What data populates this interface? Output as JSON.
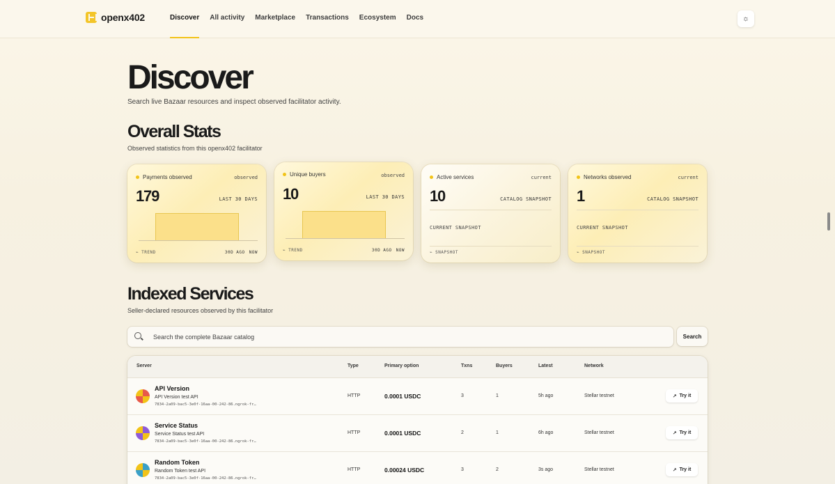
{
  "header": {
    "brand": "openx402",
    "nav": [
      "Discover",
      "All activity",
      "Marketplace",
      "Transactions",
      "Ecosystem",
      "Docs"
    ],
    "active_nav": "Discover",
    "theme_icon": "sun-icon"
  },
  "discover": {
    "title": "Discover",
    "subtitle": "Search live Bazaar resources and inspect observed facilitator activity."
  },
  "stats": {
    "title": "Overall Stats",
    "subtitle": "Observed statistics from this openx402 facilitator",
    "cards": [
      {
        "label": "Payments observed",
        "tag": "observed",
        "value": "179",
        "period": "LAST 30 DAYS",
        "foot_left": "TREND",
        "foot_from": "30D AGO",
        "foot_to": "NOW"
      },
      {
        "label": "Unique buyers",
        "tag": "observed",
        "value": "10",
        "period": "LAST 30 DAYS",
        "foot_left": "TREND",
        "foot_from": "30D AGO",
        "foot_to": "NOW"
      },
      {
        "label": "Active services",
        "tag": "current",
        "value": "10",
        "period": "CATALOG SNAPSHOT",
        "snapshot": "CURRENT SNAPSHOT",
        "foot_left": "SNAPSHOT"
      },
      {
        "label": "Networks observed",
        "tag": "current",
        "value": "1",
        "period": "CATALOG SNAPSHOT",
        "snapshot": "CURRENT SNAPSHOT",
        "foot_left": "SNAPSHOT"
      }
    ]
  },
  "services": {
    "title": "Indexed Services",
    "subtitle": "Seller-declared resources observed by this facilitator",
    "search_placeholder": "Search the complete Bazaar catalog",
    "search_button": "Search",
    "columns": [
      "Server",
      "Type",
      "Primary option",
      "Txns",
      "Buyers",
      "Latest",
      "Network"
    ],
    "try_label": "Try it",
    "rows": [
      {
        "name": "API Version",
        "desc": "API Version test API",
        "url": "7834-2a09-bac5-3e0f-16aa-00-242-86.ngrok-fr…",
        "type": "HTTP",
        "price": "0.0001 USDC",
        "txns": "3",
        "buyers": "1",
        "latest": "5h ago",
        "network": "Stellar testnet",
        "avatar_colors": [
          "#e8594a",
          "#f2c318"
        ]
      },
      {
        "name": "Service Status",
        "desc": "Service Status test API",
        "url": "7834-2a09-bac5-3e0f-16aa-00-242-86.ngrok-fr…",
        "type": "HTTP",
        "price": "0.0001 USDC",
        "txns": "2",
        "buyers": "1",
        "latest": "6h ago",
        "network": "Stellar testnet",
        "avatar_colors": [
          "#8e5bd8",
          "#f2c318"
        ]
      },
      {
        "name": "Random Token",
        "desc": "Random Token test API",
        "url": "7834-2a09-bac5-3e0f-16aa-00-242-86.ngrok-fr…",
        "type": "HTTP",
        "price": "0.00024 USDC",
        "txns": "3",
        "buyers": "2",
        "latest": "3s ago",
        "network": "Stellar testnet",
        "avatar_colors": [
          "#3aa0c8",
          "#f2c318"
        ]
      }
    ]
  }
}
